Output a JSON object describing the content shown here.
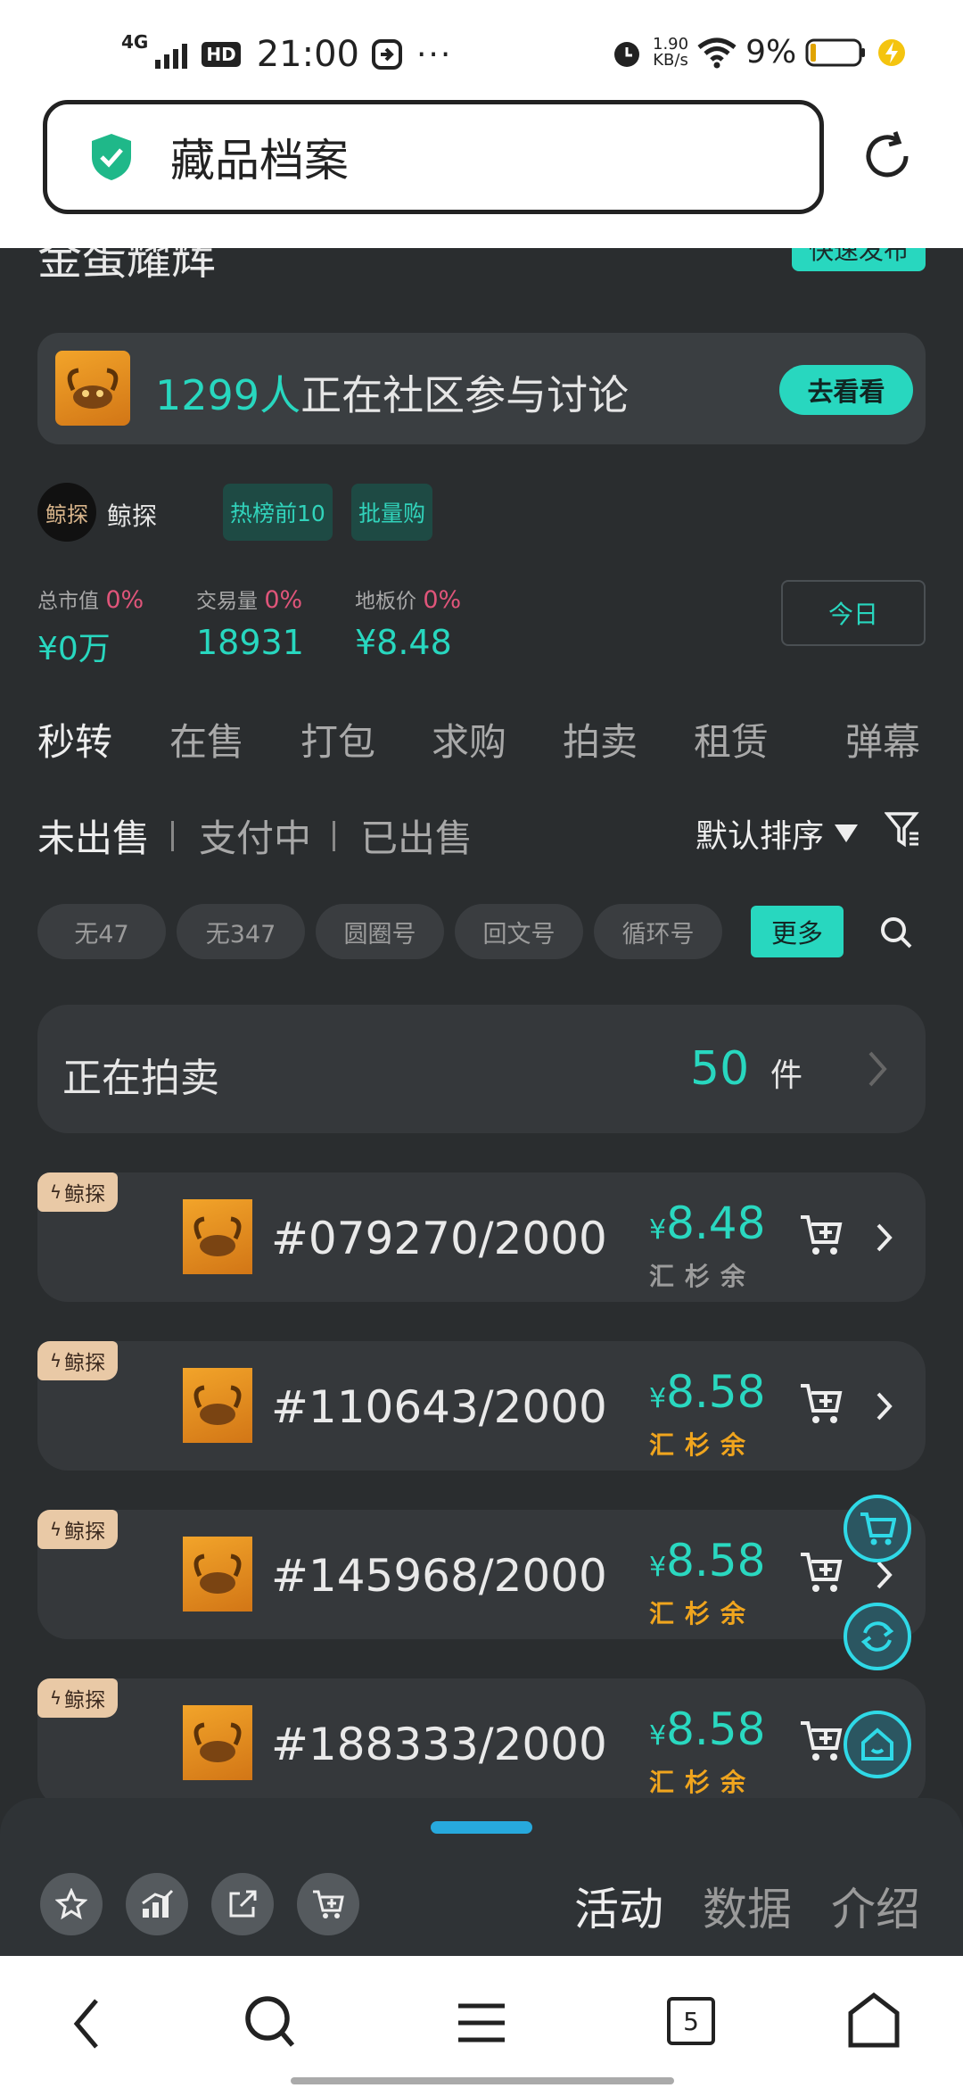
{
  "status_bar": {
    "network": "4G",
    "hd": "HD",
    "time": "21:00",
    "speed_value": "1.90",
    "speed_unit": "KB/s",
    "battery_pct": "9%"
  },
  "url_bar": {
    "title": "藏品档案"
  },
  "header": {
    "partial_title": "金蛋耀辉",
    "partial_button": "快速发布"
  },
  "discussion": {
    "count": "1299人",
    "text": "正在社区参与讨论",
    "button": "去看看"
  },
  "publisher": {
    "logo_text": "鲸探",
    "name": "鲸探",
    "tags": [
      "热榜前10",
      "批量购"
    ]
  },
  "stats": [
    {
      "label": "总市值",
      "change": "0%",
      "value": "¥0万"
    },
    {
      "label": "交易量",
      "change": "0%",
      "value": "18931"
    },
    {
      "label": "地板价",
      "change": "0%",
      "value": "¥8.48"
    }
  ],
  "period_button": "今日",
  "main_tabs": [
    "秒转",
    "在售",
    "打包",
    "求购",
    "拍卖",
    "租赁",
    "弹幕"
  ],
  "sub_tabs": [
    "未出售",
    "支付中",
    "已出售"
  ],
  "sort_label": "默认排序",
  "filter_chips": [
    "无47",
    "无347",
    "圆圈号",
    "回文号",
    "循环号"
  ],
  "more_label": "更多",
  "auction": {
    "label": "正在拍卖",
    "count": "50",
    "unit": "件"
  },
  "listings": [
    {
      "tag": "鲸探",
      "id": "#079270/2000",
      "currency": "¥",
      "price": "8.48",
      "marks": "汇杉余"
    },
    {
      "tag": "鲸探",
      "id": "#110643/2000",
      "currency": "¥",
      "price": "8.58",
      "marks": "汇杉余"
    },
    {
      "tag": "鲸探",
      "id": "#145968/2000",
      "currency": "¥",
      "price": "8.58",
      "marks": "汇杉余"
    },
    {
      "tag": "鲸探",
      "id": "#188333/2000",
      "currency": "¥",
      "price": "8.58",
      "marks": "汇杉余"
    }
  ],
  "bottom_tabs": [
    "活动",
    "数据",
    "介绍"
  ],
  "nav_tab_count": "5",
  "colors": {
    "accent": "#28d7bf",
    "background": "#2a2d2f",
    "card": "#35383b",
    "price_marks": "#f0a51e",
    "negative": "#e0557a"
  }
}
